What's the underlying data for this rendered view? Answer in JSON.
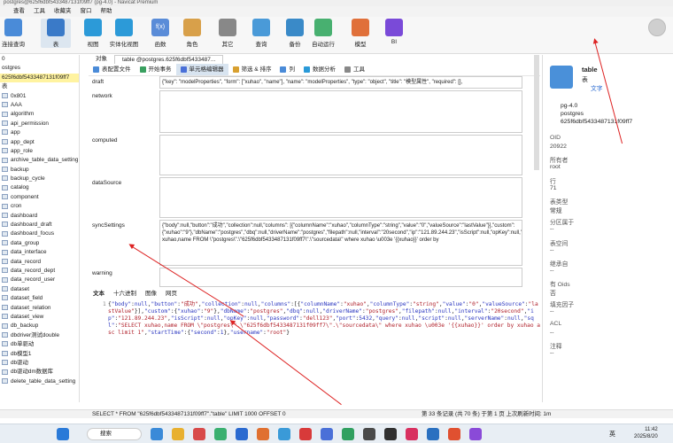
{
  "window_title": "postgres@625f6dbf5433487131f09ff7 (pg-4.0) - Navicat Premium",
  "menu": [
    "查看",
    "工具",
    "收藏夹",
    "窗口",
    "帮助"
  ],
  "ribbon": [
    {
      "label": "连接查询",
      "color": "#4a8bd8"
    },
    {
      "label": "表",
      "color": "#3a7ac8"
    },
    {
      "label": "视图",
      "color": "#2c9ad8"
    },
    {
      "label": "实体化视图",
      "color": "#2c9ad8"
    },
    {
      "label": "函数",
      "color": "#5a8cd8",
      "glyph": "f(x)"
    },
    {
      "label": "角色",
      "color": "#d8a04a"
    },
    {
      "label": "其它",
      "color": "#888888"
    },
    {
      "label": "查询",
      "color": "#4a9ad8"
    },
    {
      "label": "备份",
      "color": "#3a8ac8"
    },
    {
      "label": "自动运行",
      "color": "#48b070"
    },
    {
      "label": "模型",
      "color": "#e0703a"
    },
    {
      "label": "BI",
      "color": "#7a4ad8"
    }
  ],
  "sidebar": {
    "header_rows": [
      "0",
      "ostgres",
      "625f6dbf5433487131f09ff7",
      "表"
    ],
    "tables": [
      "0x801",
      "AAA",
      "algorithm",
      "api_permission",
      "app",
      "app_dept",
      "app_role",
      "archive_table_data_setting",
      "backup",
      "backup_cycle",
      "catalog",
      "component",
      "cron",
      "dashboard",
      "dashboard_draft",
      "dashboard_focus",
      "data_group",
      "data_interface",
      "data_record",
      "data_record_dept",
      "data_record_user",
      "dataset",
      "dataset_field",
      "dataset_relation",
      "dataset_view",
      "db_backup",
      "dbdriver测试double",
      "db单驱动",
      "db模型1",
      "db驱动",
      "db驱动dm数据库",
      "delete_table_data_setting"
    ]
  },
  "tabs": {
    "object": "对象",
    "table": "table @postgres.625f6dbf5433487..."
  },
  "toolbar": [
    "表配置文件",
    "开始事务",
    "单元格编辑器",
    "筛选 & 排序",
    "列",
    "数据分析",
    "工具"
  ],
  "fields": [
    {
      "label": "draft",
      "value": "{\"key\": \"modelProperties\", \"form\": [\"xuhao\", \"name\"], \"name\": \"modelProperties\", \"type\": \"object\", \"title\": \"模型属性\", \"required\": [],"
    },
    {
      "label": "network",
      "value": ""
    },
    {
      "label": "computed",
      "value": ""
    },
    {
      "label": "dataSource",
      "value": ""
    },
    {
      "label": "syncSettings",
      "value": "{\"body\":null,\"button\":\"成功\",\"collection\":null,\"columns\": [{\"columnName\":\"xuhao\",\"columnType\":\"string\",\"value\":\"0\",\"valueSource\":\"lastValue\"}],\"custom\": {\"xuhao\":\"9\"},\"dbName\":\"postgres\",\"dbq\":null,\"driverName\":\"postgres\",\"filepath\":null,\"interval\":\"20second\",\"ip\":\"121.89.244.23\",\"isScript\":null,\"opKey\":null,\"password\":\"dell123\",\"port\":5432,\"query\":null,\"script\":null,\"serverName\":null,\"sql\":\"SELECT xuhao,name FROM \\\"postgres\\\".\\\"625f6dbf5433487131f09ff7\\\".\\\"sourcedata\\\" where xuhao \\u003e '{{xuhao}}' order by"
    },
    {
      "label": "warning",
      "value": ""
    }
  ],
  "viewer_tabs": [
    "文本",
    "十六进制",
    "图像",
    "网页"
  ],
  "json_text": "{\"body\":null,\"button\":\"成功\",\"collection\":null,\"columns\":[{\"columnName\":\"xuhao\",\"columnType\":\"string\",\"value\":\"0\",\"valueSource\":\"lastValue\"}],\"custom\":{\"xuhao\":\"9\"},\"dbName\":\"postgres\",\"dbq\":null,\"driverName\":\"postgres\",\"filepath\":null,\"interval\":\"20second\",\"ip\":\"121.89.244.23\",\"isScript\":null,\"opKey\":null,\"password\":\"dell123\",\"port\":5432,\"query\":null,\"script\":null,\"serverName\":null,\"sql\":\"SELECT xuhao,name FROM \\\"postgres\\\".\\\"625f6dbf5433487131f09ff7\\\".\\\"sourcedata\\\" where xuhao \\u003e '{{xuhao}}' order by xuhao asc limit 1\",\"startTime\":{\"second\":1},\"username\":\"root\"}",
  "json_gutter": "1",
  "right": {
    "title": "table",
    "subtitle": "表",
    "link": "文字",
    "conn": "pg-4.0",
    "db": "postgres",
    "schema": "625f6dbf5433487131f09ff7",
    "props": [
      {
        "k": "OID",
        "v": "20922"
      },
      {
        "k": "所有者",
        "v": "root"
      },
      {
        "k": "行",
        "v": "71"
      },
      {
        "k": "表类型",
        "v": "常规"
      },
      {
        "k": "分区属于",
        "v": "--"
      },
      {
        "k": "表空间",
        "v": "--"
      },
      {
        "k": "继承自",
        "v": "--"
      },
      {
        "k": "有 Oids",
        "v": "否"
      },
      {
        "k": "填充因子",
        "v": "--"
      },
      {
        "k": "ACL",
        "v": "--"
      },
      {
        "k": "注释",
        "v": "--"
      }
    ]
  },
  "status": {
    "query": "SELECT * FROM \"625f6dbf5433487131f09ff7\".\"table\" LIMIT 1000 OFFSET 0",
    "record": "第 33 条记录 (共 70 条) 于第 1 页 上次刷新时间: 1m"
  },
  "taskbar": {
    "search": "搜索",
    "lang": "英",
    "time": "11:42",
    "date": "2025/8/20"
  }
}
